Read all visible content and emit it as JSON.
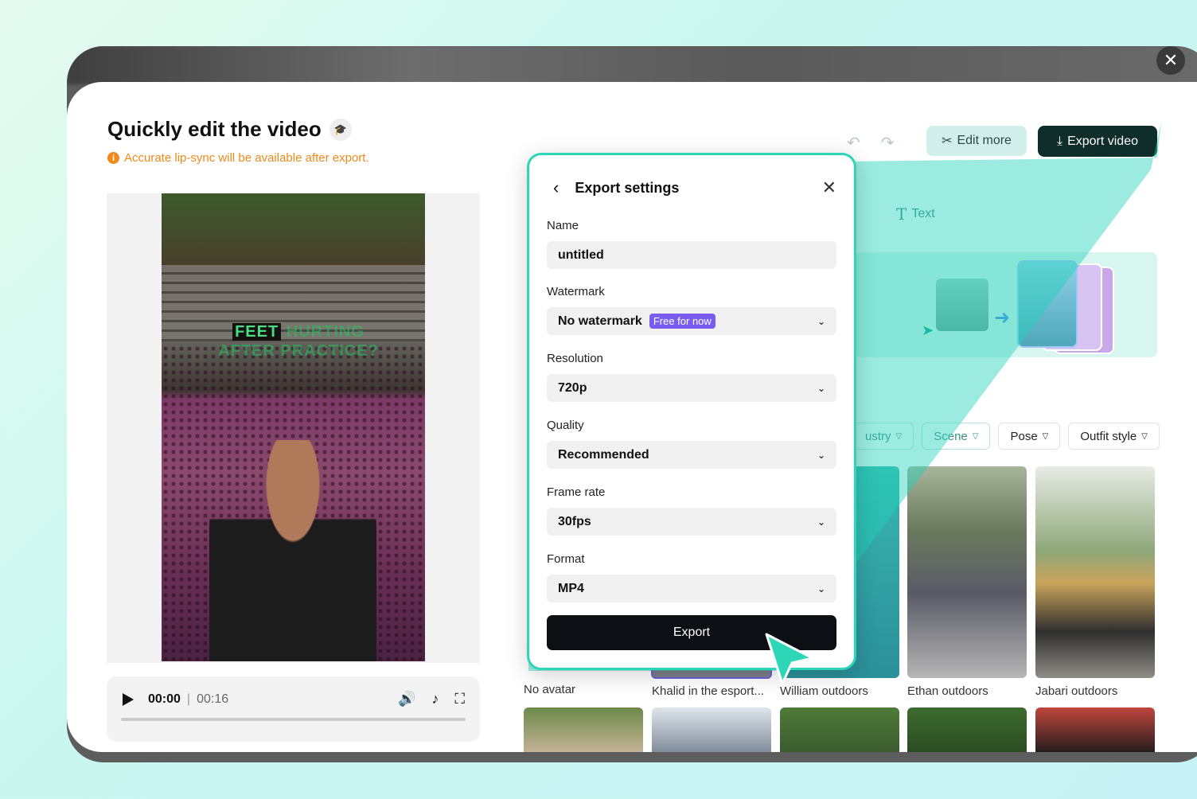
{
  "page": {
    "title": "Quickly edit the video",
    "warning": "Accurate lip-sync will be available after export.",
    "close_icon": "close-icon"
  },
  "video": {
    "caption_highlight": "FEET",
    "caption_rest": "HURTING AFTER PRACTICE?",
    "time_current": "00:00",
    "time_separator": "|",
    "time_total": "00:16",
    "progress": 0
  },
  "toolbar": {
    "edit_more_label": "Edit more",
    "export_video_label": "Export video",
    "text_tab_label": "Text"
  },
  "filters": [
    {
      "label": "ustry"
    },
    {
      "label": "Scene"
    },
    {
      "label": "Pose"
    },
    {
      "label": "Outfit style"
    }
  ],
  "avatars": [
    {
      "label": "No avatar"
    },
    {
      "label": "Khalid in the esport..."
    },
    {
      "label": "William outdoors"
    },
    {
      "label": "Ethan outdoors"
    },
    {
      "label": "Jabari outdoors"
    }
  ],
  "modal": {
    "title": "Export settings",
    "name_label": "Name",
    "name_value": "untitled",
    "watermark_label": "Watermark",
    "watermark_value": "No watermark",
    "watermark_badge": "Free for now",
    "resolution_label": "Resolution",
    "resolution_value": "720p",
    "quality_label": "Quality",
    "quality_value": "Recommended",
    "framerate_label": "Frame rate",
    "framerate_value": "30fps",
    "format_label": "Format",
    "format_value": "MP4",
    "export_label": "Export"
  },
  "colors": {
    "accent": "#2ed6b8",
    "warning": "#f08a1c",
    "badge": "#7b5cf0",
    "primary_button": "#0c0f14"
  }
}
